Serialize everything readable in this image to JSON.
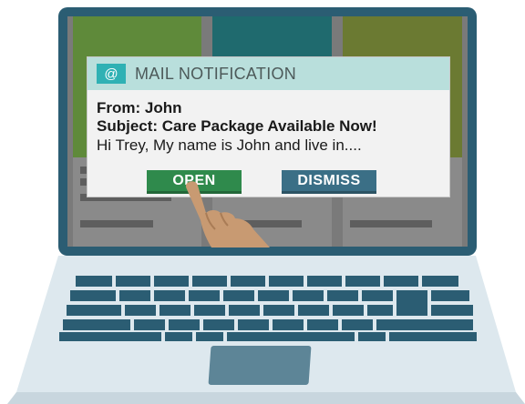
{
  "notification": {
    "icon": "@",
    "icon_name": "at-icon",
    "title": "MAIL NOTIFICATION",
    "from": "From: John",
    "subject": "Subject: Care Package Available Now!",
    "preview": "Hi Trey, My name is John and live in....",
    "open_label": "OPEN",
    "dismiss_label": "DISMISS"
  },
  "colors": {
    "bezel": "#2b5d73",
    "header": "#b9dfdc",
    "open_button": "#2f8a4c",
    "dismiss_button": "#3b6f86"
  }
}
